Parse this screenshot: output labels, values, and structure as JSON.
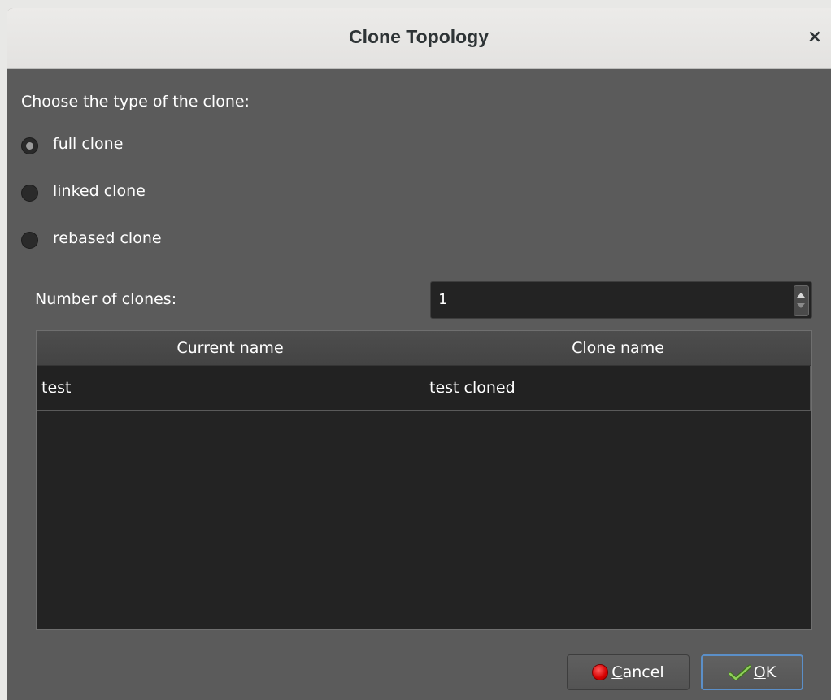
{
  "window": {
    "title": "Clone Topology",
    "close_glyph": "×"
  },
  "clone_type": {
    "prompt": "Choose the type of the clone:",
    "options": [
      {
        "label": "full clone",
        "selected": true
      },
      {
        "label": "linked clone",
        "selected": false
      },
      {
        "label": "rebased clone",
        "selected": false
      }
    ]
  },
  "clones": {
    "count_label": "Number of clones:",
    "count_value": "1"
  },
  "table": {
    "headers": [
      "Current name",
      "Clone name"
    ],
    "rows": [
      {
        "current": "test",
        "clone": "test cloned"
      }
    ]
  },
  "buttons": {
    "cancel_mnemonic": "C",
    "cancel_rest": "ancel",
    "ok_mnemonic": "O",
    "ok_rest": "K"
  },
  "icons": {
    "cancel": "stop-icon",
    "ok": "checkmark-icon"
  },
  "colors": {
    "dialog_bg": "#5b5b5b",
    "field_bg": "#232323",
    "ok_focus_border": "#5b8fc8",
    "cancel_icon_red": "#d40000"
  }
}
